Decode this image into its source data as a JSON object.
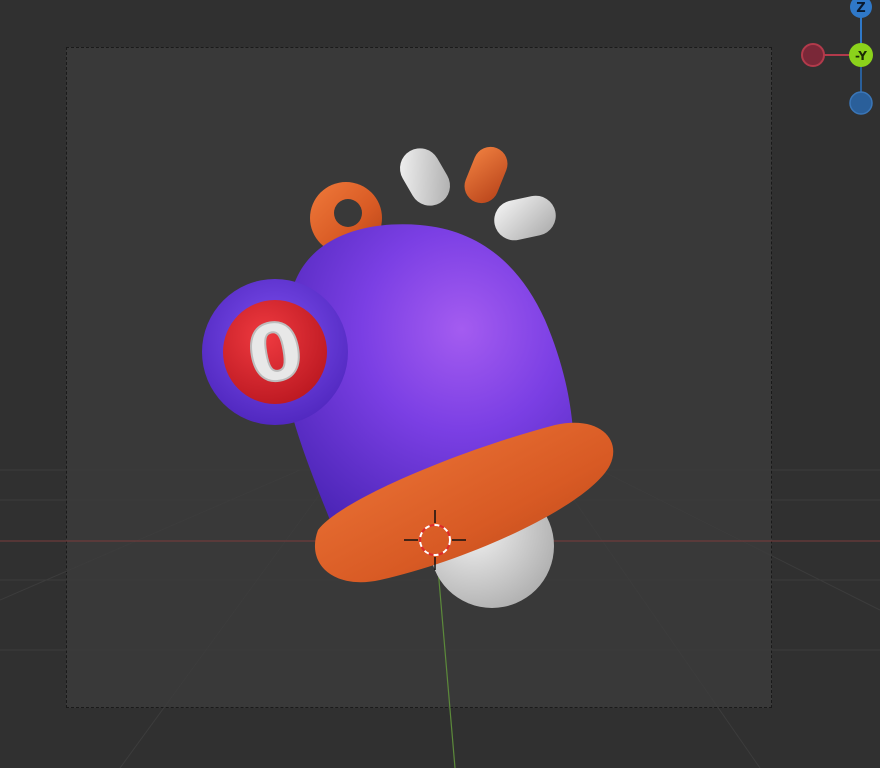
{
  "app": {
    "window": "3D Viewport"
  },
  "gizmo": {
    "axes": [
      {
        "name": "Z",
        "label": "Z",
        "color": "#2f78c8"
      },
      {
        "name": "Y",
        "label": "-Y",
        "color": "#8bd21b"
      },
      {
        "name": "X",
        "label": "",
        "color": "#b23a4b"
      },
      {
        "name": "-Z",
        "label": "",
        "color": "#2a5f9a"
      }
    ]
  },
  "colors": {
    "background": "#303030",
    "camera_frame": "#393939",
    "bell_body": "#7b3fe4",
    "bell_rim": "#e0612a",
    "badge_red": "#d8262f",
    "badge_ring": "#6636d4",
    "clapper": "#d9d9d9"
  },
  "badge": {
    "count": "0"
  },
  "icons": [
    "bell-icon",
    "3d-cursor-icon",
    "navigation-gizmo"
  ]
}
